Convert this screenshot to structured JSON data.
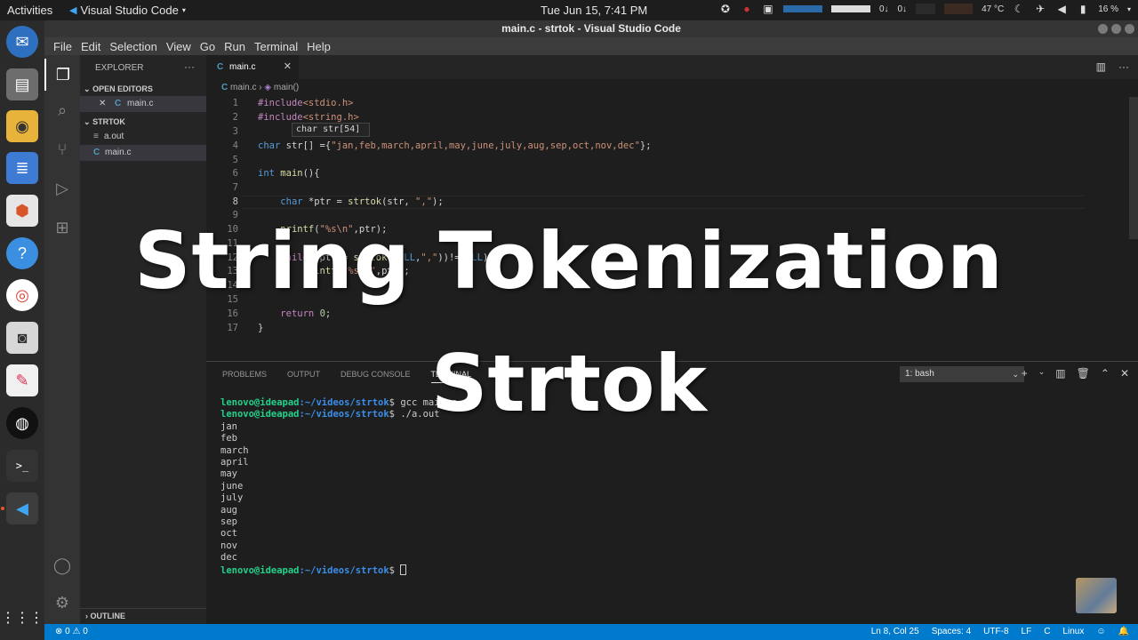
{
  "topbar": {
    "activities": "Activities",
    "app_name": "Visual Studio Code",
    "clock": "Tue Jun 15,  7:41 PM",
    "temp": "47 °C",
    "battery": "16 %",
    "net1": "0↓",
    "net2": "0↓"
  },
  "window": {
    "title": "main.c - strtok - Visual Studio Code"
  },
  "menu": [
    "File",
    "Edit",
    "Selection",
    "View",
    "Go",
    "Run",
    "Terminal",
    "Help"
  ],
  "sidebar": {
    "header": "EXPLORER",
    "open_editors": "OPEN EDITORS",
    "open_file": "main.c",
    "folder": "STRTOK",
    "files": [
      "a.out",
      "main.c"
    ],
    "outline": "OUTLINE"
  },
  "editor": {
    "tab": "main.c",
    "breadcrumb_file": "main.c",
    "breadcrumb_symbol": "main()",
    "hover": "char str[54]",
    "line_numbers": [
      "1",
      "2",
      "3",
      "4",
      "5",
      "6",
      "7",
      "8",
      "9",
      "10",
      "11",
      "12",
      "13",
      "14",
      "15",
      "16",
      "17"
    ]
  },
  "panel": {
    "tabs": [
      "PROBLEMS",
      "OUTPUT",
      "DEBUG CONSOLE",
      "TERMINAL"
    ],
    "shell": "1: bash",
    "prompt_user": "lenovo@ideapad",
    "prompt_path": ":~/videos/strtok",
    "cmd1": "$ gcc main.c",
    "cmd2": "$ ./a.out",
    "output": [
      "jan",
      "feb",
      "march",
      "april",
      "may",
      "june",
      "july",
      "aug",
      "sep",
      "oct",
      "nov",
      "dec"
    ],
    "last_prompt_suffix": "$ "
  },
  "status": {
    "errors": "⊗ 0 ⚠ 0",
    "position": "Ln 8, Col 25",
    "spaces": "Spaces: 4",
    "encoding": "UTF-8",
    "eol": "LF",
    "language": "C",
    "os": "Linux"
  },
  "overlay": {
    "line1": "String Tokenization",
    "line2": "Strtok"
  }
}
